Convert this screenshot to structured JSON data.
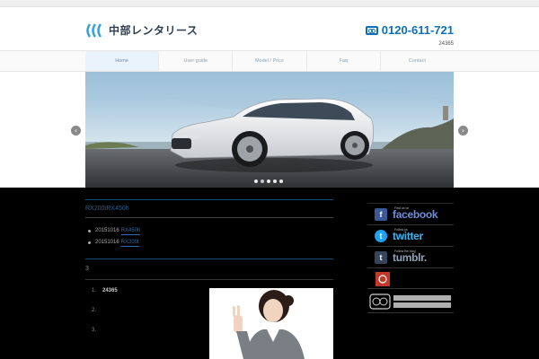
{
  "header": {
    "logo_text": "中部レンタリース",
    "phone_number": "0120-611-721",
    "phone_sub": "24365"
  },
  "nav": {
    "items": [
      {
        "label": "Home"
      },
      {
        "label": "User guide"
      },
      {
        "label": "Model / Price"
      },
      {
        "label": "Faq"
      },
      {
        "label": "Contact"
      }
    ]
  },
  "slider": {
    "dots": 5,
    "active_dot": 2,
    "prev_label": "‹",
    "next_label": "›"
  },
  "post": {
    "title": "RX200tRX450h",
    "news": [
      {
        "date": "20151016",
        "link": "RX450h"
      },
      {
        "date": "20151016",
        "link": "RX200t"
      }
    ]
  },
  "section": {
    "number": "3",
    "list": [
      {
        "num": "1.",
        "value": "24365"
      },
      {
        "num": "2.",
        "value": ""
      },
      {
        "num": "3.",
        "value": ""
      }
    ]
  },
  "sidebar": {
    "facebook": {
      "prefix": "Find us on",
      "text": "facebook"
    },
    "twitter": {
      "prefix": "Follow us",
      "text": "twitter"
    },
    "tumblr": {
      "prefix": "Follow the blog",
      "text": "tumblr."
    }
  },
  "colors": {
    "brand": "#0f6fb0",
    "link": "#2e6aa8",
    "main_bg": "#000000"
  }
}
